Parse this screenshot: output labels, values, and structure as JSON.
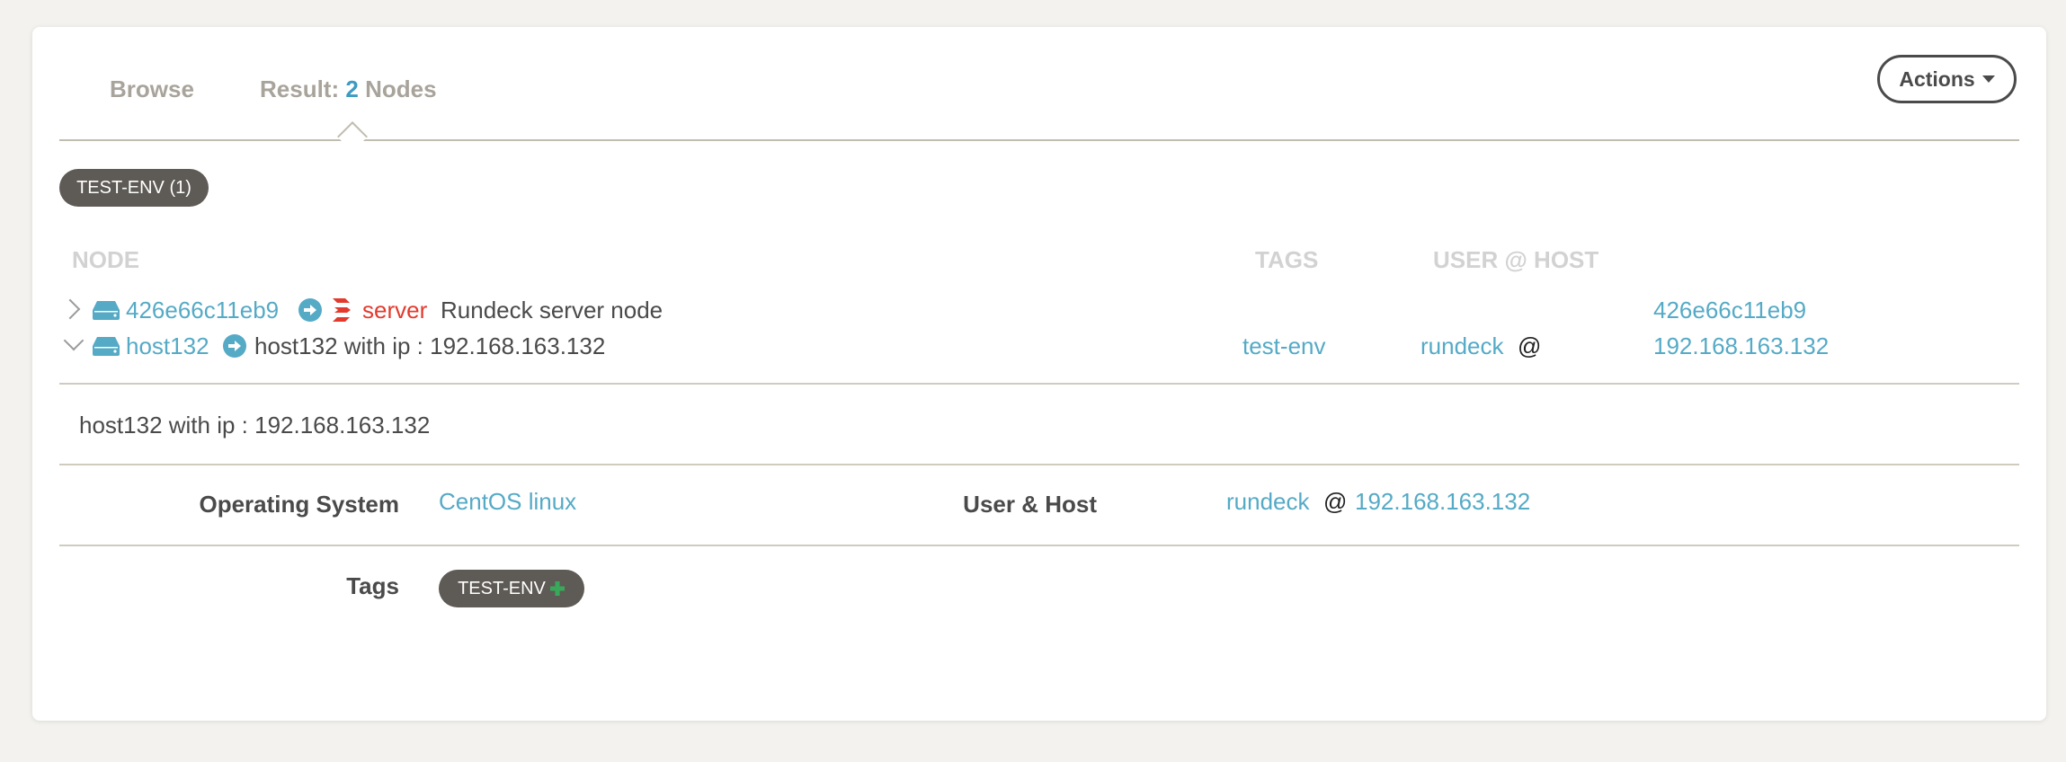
{
  "tabs": {
    "browse": "Browse",
    "result_prefix": "Result:",
    "result_count": "2",
    "result_suffix": "Nodes"
  },
  "actions_label": "Actions",
  "filter_tag": "TEST-ENV (1)",
  "columns": {
    "node": "NODE",
    "tags": "TAGS",
    "user_host": "USER @ HOST"
  },
  "nodes": [
    {
      "name": "426e66c11eb9",
      "role": "server",
      "description": "Rundeck server node",
      "hostname": "426e66c11eb9"
    },
    {
      "name": "host132",
      "description": "host132 with ip : 192.168.163.132",
      "tags": "test-env",
      "user": "rundeck",
      "at": "@",
      "hostname": "192.168.163.132"
    }
  ],
  "detail": {
    "description": "host132 with ip : 192.168.163.132",
    "os_label": "Operating System",
    "os_value": "CentOS linux",
    "userhost_label": "User & Host",
    "user": "rundeck",
    "at": "@",
    "host": "192.168.163.132",
    "tags_label": "Tags",
    "tag": "TEST-ENV"
  },
  "colors": {
    "link": "#55aac6",
    "accent_count": "#3d9bc2",
    "server_red": "#e23b2e",
    "pill_bg": "#5e5a55",
    "plus_green": "#3aa85a"
  },
  "icons": [
    "chevron-right-icon",
    "chevron-down-icon",
    "server-icon",
    "arrow-right-circle-icon",
    "rundeck-logo-icon",
    "plus-icon",
    "caret-down-icon"
  ]
}
